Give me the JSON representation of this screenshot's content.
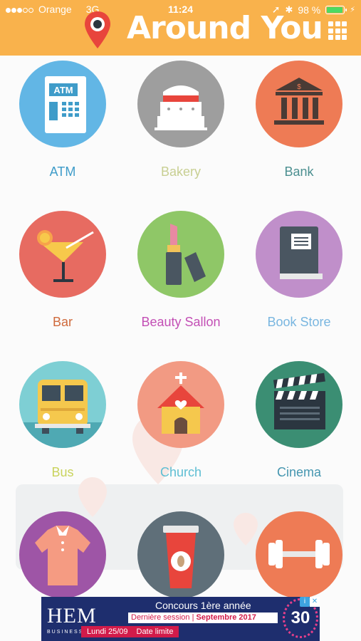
{
  "status_bar": {
    "carrier": "Orange",
    "network": "3G",
    "time": "11:24",
    "battery": "98 %",
    "battery_level": 0.98
  },
  "header": {
    "title": "Around You",
    "pin_icon": "map-pin-icon",
    "menu_icon": "grid-menu-icon",
    "color": "#f9b24c"
  },
  "categories": [
    {
      "label": "ATM",
      "color": "#3f9cc9",
      "circle": "#62b6e5",
      "icon": "atm-icon"
    },
    {
      "label": "Bakery",
      "color": "#c8cf92",
      "circle": "#9e9e9e",
      "icon": "cake-icon"
    },
    {
      "label": "Bank",
      "color": "#4b8f90",
      "circle": "#ee7b55",
      "icon": "bank-icon"
    },
    {
      "label": "Bar",
      "color": "#cf6a3c",
      "circle": "#e76b61",
      "icon": "cocktail-icon"
    },
    {
      "label": "Beauty Sallon",
      "color": "#c34fb5",
      "circle": "#8fc767",
      "icon": "lipstick-icon"
    },
    {
      "label": "Book Store",
      "color": "#79b6e0",
      "circle": "#c08fca",
      "icon": "book-icon"
    },
    {
      "label": "Bus",
      "color": "#c9d35c",
      "circle": "#7ecfd4",
      "icon": "bus-icon"
    },
    {
      "label": "Church",
      "color": "#5ebed3",
      "circle": "#f29a83",
      "icon": "church-icon"
    },
    {
      "label": "Cinema",
      "color": "#4596b0",
      "circle": "#3b8e73",
      "icon": "clapperboard-icon"
    },
    {
      "label": "",
      "color": "#999999",
      "circle": "#9e55a6",
      "icon": "shirt-icon"
    },
    {
      "label": "",
      "color": "#999999",
      "circle": "#5f6f79",
      "icon": "coffee-cup-icon"
    },
    {
      "label": "",
      "color": "#999999",
      "circle": "#ee7b55",
      "icon": "dumbbell-icon"
    }
  ],
  "ad": {
    "logo": "HEM",
    "logo_sub": "BUSINESS SCHOOL",
    "contest": "Concours 1ère année",
    "session_prefix": "Dernière session | ",
    "session_month": "Septembre 2017",
    "date": "Lundi 25/09",
    "deadline": "Date limite",
    "badge": "30"
  }
}
